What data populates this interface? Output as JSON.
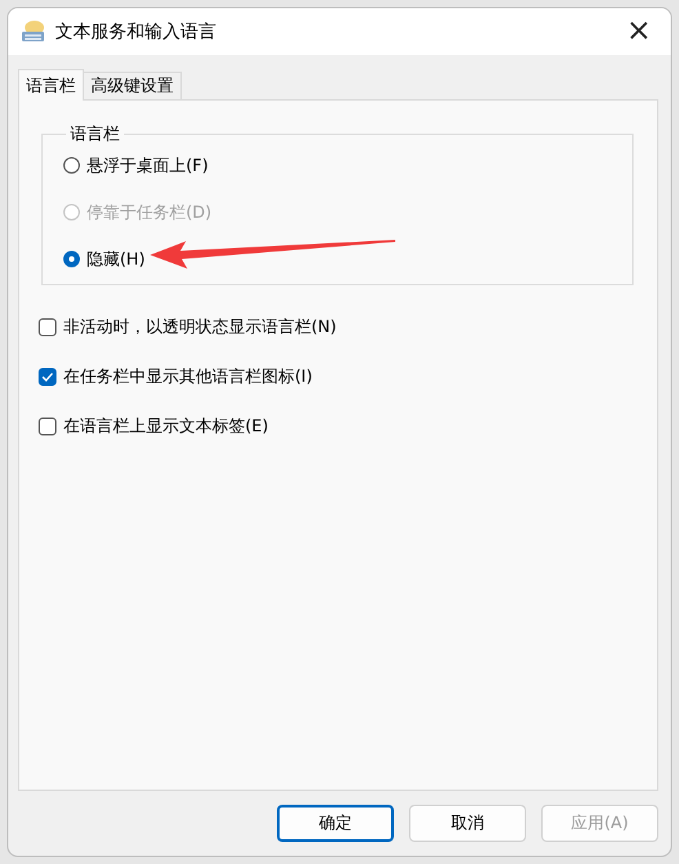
{
  "window": {
    "title": "文本服务和输入语言",
    "close": "×"
  },
  "tabs": [
    {
      "label": "语言栏",
      "selected": true
    },
    {
      "label": "高级键设置",
      "selected": false
    }
  ],
  "group": {
    "title": "语言栏",
    "options": [
      {
        "label": "悬浮于桌面上(F)",
        "selected": false,
        "disabled": false
      },
      {
        "label": "停靠于任务栏(D)",
        "selected": false,
        "disabled": true
      },
      {
        "label": "隐藏(H)",
        "selected": true,
        "disabled": false
      }
    ]
  },
  "checkboxes": [
    {
      "label": "非活动时，以透明状态显示语言栏(N)",
      "checked": false
    },
    {
      "label": "在任务栏中显示其他语言栏图标(I)",
      "checked": true
    },
    {
      "label": "在语言栏上显示文本标签(E)",
      "checked": false
    }
  ],
  "buttons": [
    {
      "label": "确定",
      "default": true,
      "disabled": false
    },
    {
      "label": "取消",
      "default": false,
      "disabled": false
    },
    {
      "label": "应用(A)",
      "default": false,
      "disabled": true
    }
  ]
}
